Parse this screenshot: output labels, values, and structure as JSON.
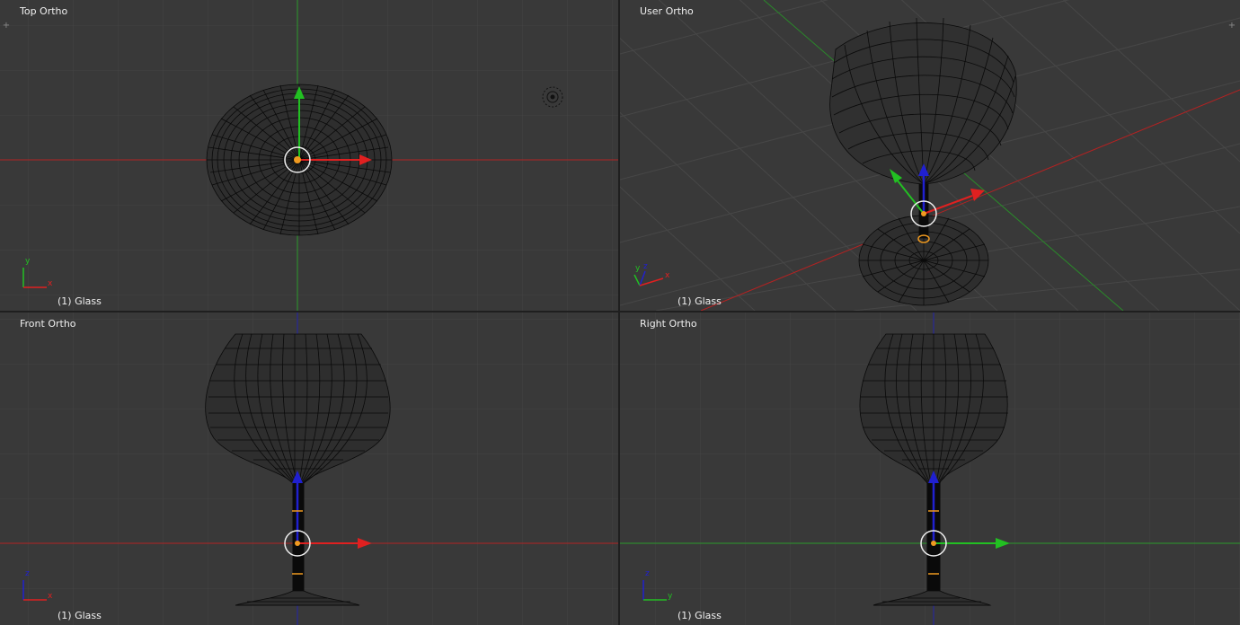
{
  "viewports": {
    "top": {
      "title": "Top Ortho",
      "object_label": "(1) Glass",
      "axis_labels": [
        "y",
        "x"
      ]
    },
    "user": {
      "title": "User Ortho",
      "object_label": "(1) Glass",
      "axis_labels": [
        "y",
        "z",
        "x"
      ]
    },
    "front": {
      "title": "Front Ortho",
      "object_label": "(1) Glass",
      "axis_labels": [
        "z",
        "x"
      ]
    },
    "right": {
      "title": "Right Ortho",
      "object_label": "(1) Glass",
      "axis_labels": [
        "z",
        "y"
      ]
    }
  },
  "colors": {
    "viewport_bg": "#393939",
    "grid": "#454545",
    "x_axis": "#d22020",
    "y_axis": "#2aa02a",
    "z_axis": "#2222cc",
    "wire": "#000000",
    "selected": "#f0961e",
    "widget_ring": "#f0f0f0",
    "text": "#f0f0f0"
  },
  "icons": [
    "viewport-corner-plus-icon",
    "camera-object-icon",
    "transform-manipulator-icon",
    "axis-gizmo-icon"
  ]
}
